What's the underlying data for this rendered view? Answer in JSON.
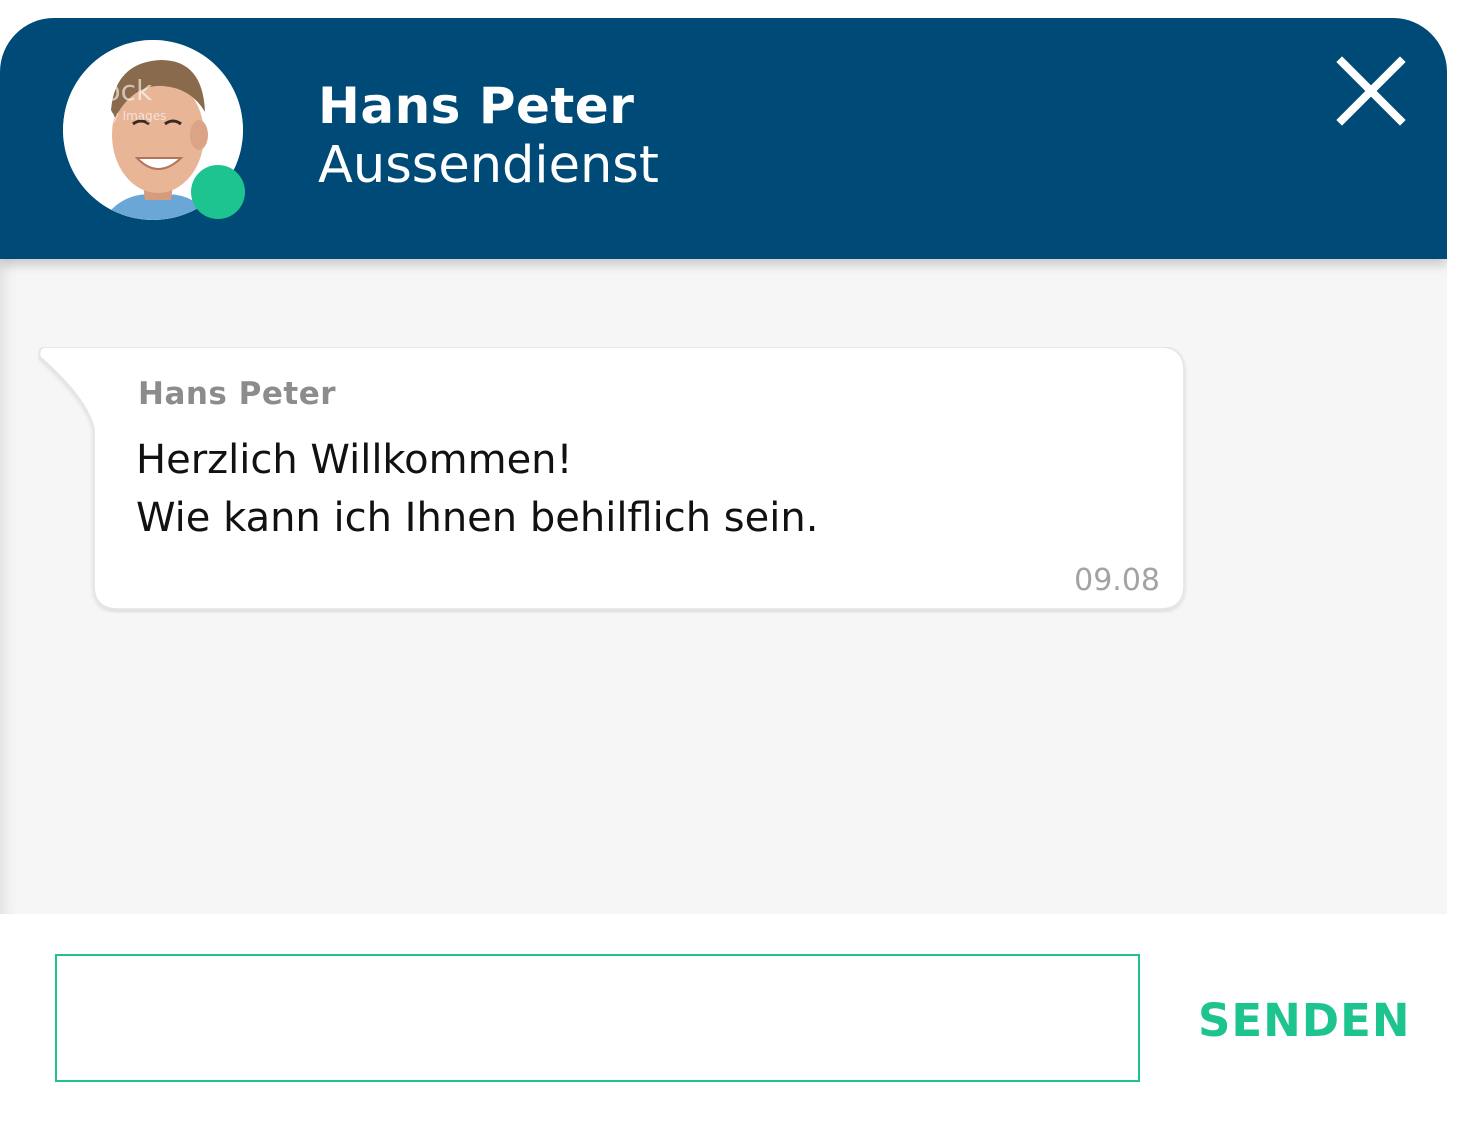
{
  "header": {
    "name": "Hans Peter",
    "role": "Aussendienst",
    "status": "online",
    "avatar_watermark": "iStock by Getty Images"
  },
  "messages": [
    {
      "sender": "Hans Peter",
      "lines": [
        "Herzlich Willkommen!",
        "Wie kann ich Ihnen behilflich sein."
      ],
      "time": "09.08"
    }
  ],
  "composer": {
    "placeholder": "",
    "value": "",
    "send_label": "SENDEN"
  },
  "icons": {
    "close": "close-icon",
    "status": "online-status-dot"
  },
  "colors": {
    "header_bg": "#004a77",
    "accent": "#1dc48f",
    "chat_bg": "#f6f6f6"
  }
}
